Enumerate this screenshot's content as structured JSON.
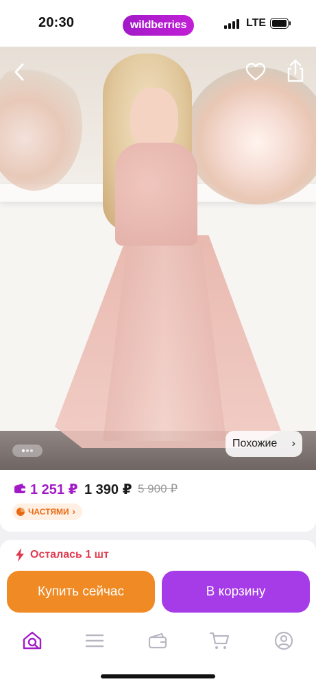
{
  "status_bar": {
    "time": "20:30",
    "brand": "wildberries",
    "network": "LTE",
    "icons": [
      "signal-icon",
      "battery-icon"
    ]
  },
  "hero": {
    "icons": [
      "chevron-left-icon",
      "heart-icon",
      "share-icon"
    ],
    "similar_label": "Похожие",
    "similar_icon": "chevron-right-icon"
  },
  "price": {
    "wallet_price": "1 251 ₽",
    "price": "1 390 ₽",
    "old_price": "5 900 ₽",
    "installment_label": "ЧАСТЯМИ",
    "installment_icon": "pie-icon",
    "wallet_icon": "wallet-icon"
  },
  "stock": {
    "icon": "lightning-icon",
    "text": "Осталась 1 шт"
  },
  "actions": {
    "buy_now": "Купить сейчас",
    "add_to_cart": "В корзину"
  },
  "tab_bar": {
    "tabs": [
      "home-search-icon",
      "menu-icon",
      "wallet-icon",
      "cart-icon",
      "profile-icon"
    ],
    "active_tab": "home-search-icon"
  },
  "colors": {
    "brand": "#a21ac8",
    "wallet_price": "#a21ac8",
    "stock": "#e03a4f",
    "buy_now": "#f08a24",
    "cart": "#a63ce8",
    "installment": "#ea6a14"
  }
}
